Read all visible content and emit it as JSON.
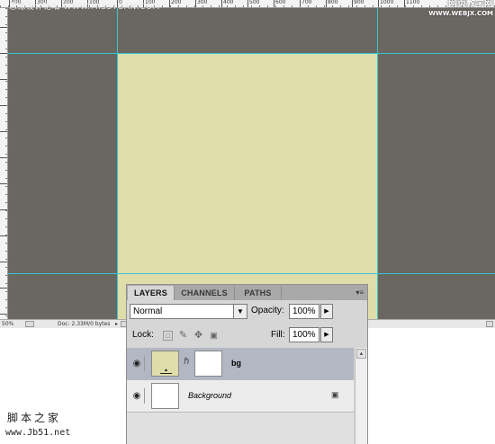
{
  "watermark": {
    "top_left": "思缘设计论坛 WWW.MISSYUAN.COM",
    "top_right_line1": "网页教学网",
    "top_right_line2": "WWW.WEBJX.COM",
    "bottom_line1": "脚本之家",
    "bottom_line2": "www.Jb51.net"
  },
  "ruler": {
    "top_labels": [
      "400",
      "300",
      "200",
      "100",
      "0",
      "100",
      "200",
      "300",
      "400",
      "500",
      "600",
      "700",
      "800",
      "900",
      "1000",
      "1100"
    ]
  },
  "canvas": {
    "background_color": "#6a6760",
    "document_color": "#dfdeab",
    "guide_color": "#35c6d6"
  },
  "status_bar": {
    "zoom": "50%",
    "doc_size": "Doc: 2.33M/0 bytes",
    "arrow_icon": "triangle-right-icon"
  },
  "layers_panel": {
    "tabs": [
      "LAYERS",
      "CHANNELS",
      "PATHS"
    ],
    "active_tab": "LAYERS",
    "menu_icon": "panel-menu-icon",
    "blend_mode": "Normal",
    "opacity_label": "Opacity:",
    "opacity_value": "100%",
    "lock_label": "Lock:",
    "fill_label": "Fill:",
    "fill_value": "100%",
    "layers": [
      {
        "name": "bg",
        "selected": true,
        "visible": true,
        "has_mask": true,
        "thumb_color": "#dfdeab"
      },
      {
        "name": "Background",
        "selected": false,
        "visible": true,
        "locked": true,
        "thumb_color": "#ffffff"
      }
    ]
  }
}
